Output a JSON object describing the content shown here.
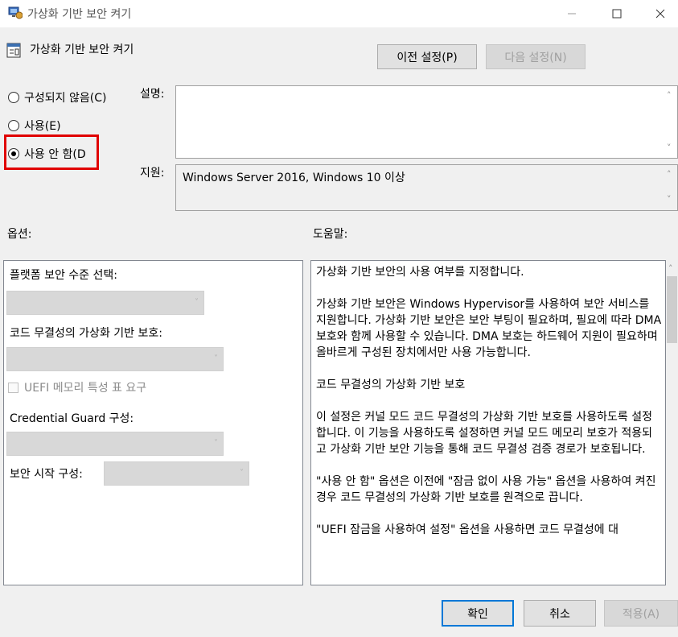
{
  "window": {
    "title": "가상화 기반 보안 켜기"
  },
  "header": {
    "title": "가상화 기반 보안 켜기",
    "prev_label": "이전 설정(P)",
    "next_label": "다음 설정(N)"
  },
  "state": {
    "options": [
      {
        "label": "구성되지 않음(C)",
        "selected": false
      },
      {
        "label": "사용(E)",
        "selected": false
      },
      {
        "label": "사용 안 함(D",
        "selected": true
      }
    ]
  },
  "info": {
    "comment_label": "설명:",
    "comment_value": "",
    "supported_label": "지원:",
    "supported_value": "Windows Server 2016, Windows 10 이상"
  },
  "options_section": {
    "label": "옵션:",
    "platform_label": "플랫폼 보안 수준 선택:",
    "hvci_label": "코드 무결성의 가상화 기반 보호:",
    "uefi_checkbox_label": "UEFI 메모리 특성 표 요구",
    "credential_guard_label": "Credential  Guard 구성:",
    "secure_launch_label": "보안 시작 구성:"
  },
  "help_section": {
    "label": "도움말:",
    "paragraphs": [
      "가상화 기반 보안의 사용 여부를 지정합니다.",
      "가상화 기반 보안은 Windows Hypervisor를 사용하여 보안 서비스를 지원합니다. 가상화 기반 보안은 보안 부팅이 필요하며, 필요에 따라 DMA 보호와 함께 사용할 수 있습니다. DMA 보호는 하드웨어 지원이 필요하며 올바르게 구성된 장치에서만 사용 가능합니다.",
      "코드 무결성의 가상화 기반 보호",
      "이 설정은 커널 모드 코드 무결성의 가상화 기반 보호를 사용하도록 설정합니다. 이 기능을 사용하도록 설정하면 커널 모드 메모리 보호가 적용되고 가상화 기반 보안 기능을 통해 코드 무결성 검증 경로가 보호됩니다.",
      "\"사용 안 함\" 옵션은 이전에 \"잠금 없이 사용 가능\" 옵션을 사용하여 켜진 경우 코드 무결성의 가상화 기반 보호를 원격으로 끕니다.",
      "\"UEFI 잠금을 사용하여 설정\" 옵션을 사용하면 코드 무결성에 대"
    ]
  },
  "footer": {
    "ok_label": "확인",
    "cancel_label": "취소",
    "apply_label": "적용(A)"
  },
  "colors": {
    "highlight": "#e00000",
    "accent": "#0078d7"
  }
}
